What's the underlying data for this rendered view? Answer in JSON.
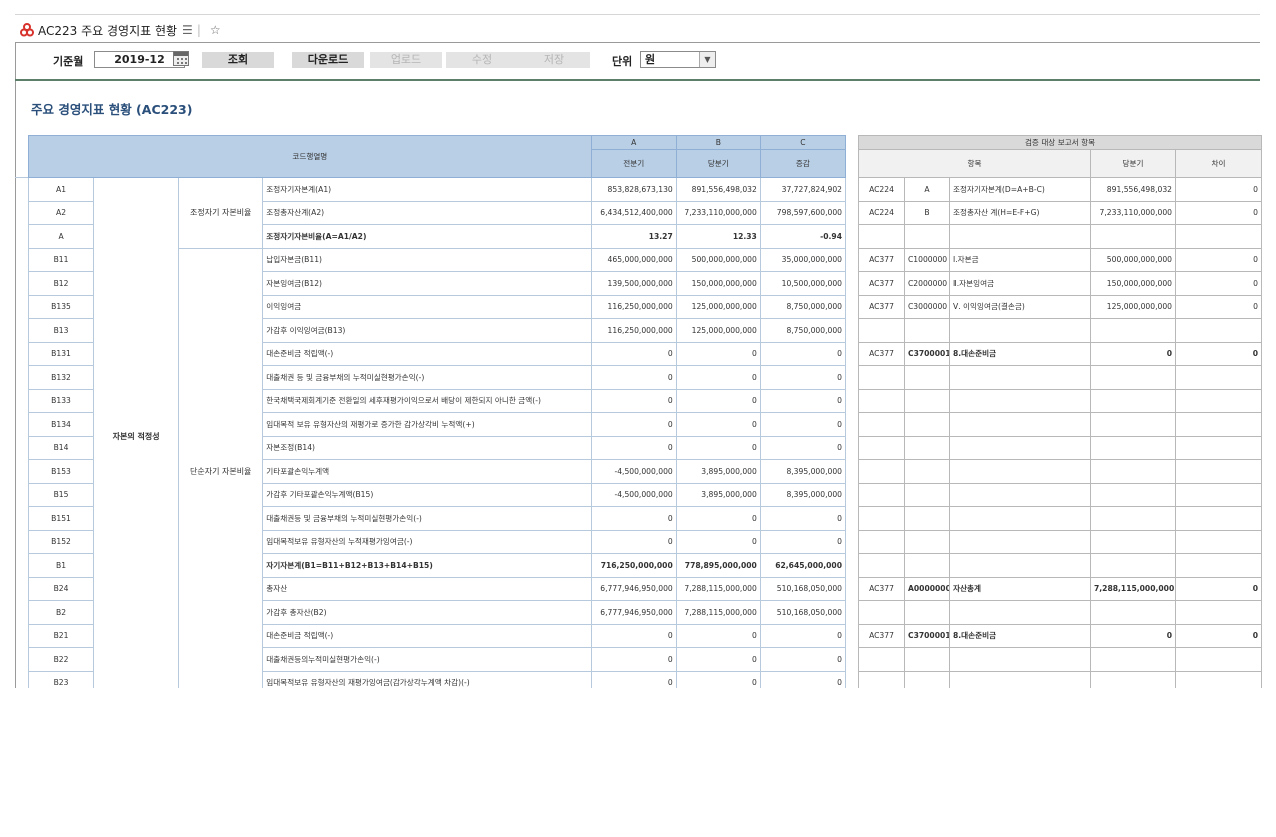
{
  "title_bar": {
    "title": "AC223 주요 경영지표 현황"
  },
  "toolbar": {
    "period_label": "기준월",
    "period_value": "2019-12",
    "search_label": "조회",
    "download_label": "다운로드",
    "upload_label": "업로드",
    "edit_label": "수정",
    "save_label": "저장",
    "unit_label": "단위",
    "unit_value": "원"
  },
  "page_title": "주요 경영지표 현황 (AC223)",
  "main_header": {
    "code_label": "코드행열명",
    "col_a": "A",
    "col_b": "B",
    "col_c": "C",
    "col_a_sub": "전분기",
    "col_b_sub": "당분기",
    "col_c_sub": "증감"
  },
  "side_header": {
    "group": "검증 대상 보고서 항목",
    "item": "항목",
    "current": "당분기",
    "diff": "차이"
  },
  "groups": {
    "level1_bottom": "자본의 적정성",
    "level2_adj": "조정자기 자본비율",
    "level2_simple": "단순자기 자본비율"
  },
  "rows": [
    {
      "code": "A1",
      "name": "조정자기자본계(A1)",
      "a": "853,828,673,130",
      "b": "891,556,498,032",
      "c": "37,727,824,902",
      "bold": false,
      "v": {
        "rpt": "AC224",
        "acct": "A",
        "item": "조정자기자본계(D=A+B-C)",
        "cur": "891,556,498,032",
        "diff": "0",
        "bold": false
      }
    },
    {
      "code": "A2",
      "name": "조정총자산계(A2)",
      "a": "6,434,512,400,000",
      "b": "7,233,110,000,000",
      "c": "798,597,600,000",
      "bold": false,
      "v": {
        "rpt": "AC224",
        "acct": "B",
        "item": "조정총자산 계(H=E-F+G)",
        "cur": "7,233,110,000,000",
        "diff": "0",
        "bold": false
      }
    },
    {
      "code": "A",
      "name": "조정자기자본비율(A=A1/A2)",
      "a": "13.27",
      "b": "12.33",
      "c": "-0.94",
      "bold": true,
      "v": {
        "rpt": "",
        "acct": "",
        "item": "",
        "cur": "",
        "diff": "",
        "bold": false
      }
    },
    {
      "code": "B11",
      "name": "납입자본금(B11)",
      "a": "465,000,000,000",
      "b": "500,000,000,000",
      "c": "35,000,000,000",
      "bold": false,
      "v": {
        "rpt": "AC377",
        "acct": "C1000000",
        "item": "Ⅰ.자본금",
        "cur": "500,000,000,000",
        "diff": "0",
        "bold": false
      }
    },
    {
      "code": "B12",
      "name": "자본잉여금(B12)",
      "a": "139,500,000,000",
      "b": "150,000,000,000",
      "c": "10,500,000,000",
      "bold": false,
      "v": {
        "rpt": "AC377",
        "acct": "C2000000",
        "item": "Ⅱ.자본잉여금",
        "cur": "150,000,000,000",
        "diff": "0",
        "bold": false
      }
    },
    {
      "code": "B135",
      "name": "이익잉여금",
      "a": "116,250,000,000",
      "b": "125,000,000,000",
      "c": "8,750,000,000",
      "bold": false,
      "v": {
        "rpt": "AC377",
        "acct": "C3000000",
        "item": "Ⅴ. 이익잉여금(결손금)",
        "cur": "125,000,000,000",
        "diff": "0",
        "bold": false
      }
    },
    {
      "code": "B13",
      "name": "가감후 이익잉여금(B13)",
      "a": "116,250,000,000",
      "b": "125,000,000,000",
      "c": "8,750,000,000",
      "bold": false,
      "v": {
        "rpt": "",
        "acct": "",
        "item": "",
        "cur": "",
        "diff": "",
        "bold": false
      }
    },
    {
      "code": "B131",
      "name": "대손준비금 적립액(-)",
      "a": "0",
      "b": "0",
      "c": "0",
      "bold": false,
      "v": {
        "rpt": "AC377",
        "acct": "C3700001",
        "item": "8.대손준비금",
        "cur": "0",
        "diff": "0",
        "bold": true
      }
    },
    {
      "code": "B132",
      "name": "대출채권 등 및 금융부채의 누적미실현평가손익(-)",
      "a": "0",
      "b": "0",
      "c": "0",
      "bold": false,
      "v": {
        "rpt": "",
        "acct": "",
        "item": "",
        "cur": "",
        "diff": "",
        "bold": false
      }
    },
    {
      "code": "B133",
      "name": "한국채택국제회계기준 전환일의 세후재평가이익으로서 배당이 제한되지 아니한 금액(-)",
      "a": "0",
      "b": "0",
      "c": "0",
      "bold": false,
      "v": {
        "rpt": "",
        "acct": "",
        "item": "",
        "cur": "",
        "diff": "",
        "bold": false
      }
    },
    {
      "code": "B134",
      "name": "임대목적 보유 유형자산의 재평가로 증가한 감가상각비 누적액(+)",
      "a": "0",
      "b": "0",
      "c": "0",
      "bold": false,
      "v": {
        "rpt": "",
        "acct": "",
        "item": "",
        "cur": "",
        "diff": "",
        "bold": false
      }
    },
    {
      "code": "B14",
      "name": "자본조정(B14)",
      "a": "0",
      "b": "0",
      "c": "0",
      "bold": false,
      "v": {
        "rpt": "",
        "acct": "",
        "item": "",
        "cur": "",
        "diff": "",
        "bold": false
      }
    },
    {
      "code": "B153",
      "name": "기타포괄손익누계액",
      "a": "-4,500,000,000",
      "b": "3,895,000,000",
      "c": "8,395,000,000",
      "bold": false,
      "v": {
        "rpt": "",
        "acct": "",
        "item": "",
        "cur": "",
        "diff": "",
        "bold": false
      }
    },
    {
      "code": "B15",
      "name": "가감후 기타포괄손익누계액(B15)",
      "a": "-4,500,000,000",
      "b": "3,895,000,000",
      "c": "8,395,000,000",
      "bold": false,
      "v": {
        "rpt": "",
        "acct": "",
        "item": "",
        "cur": "",
        "diff": "",
        "bold": false
      }
    },
    {
      "code": "B151",
      "name": "대출채권등 및 금융부채의 누적미실현평가손익(-)",
      "a": "0",
      "b": "0",
      "c": "0",
      "bold": false,
      "v": {
        "rpt": "",
        "acct": "",
        "item": "",
        "cur": "",
        "diff": "",
        "bold": false
      }
    },
    {
      "code": "B152",
      "name": "임대목적보유 유형자산의 누적재평가잉여금(-)",
      "a": "0",
      "b": "0",
      "c": "0",
      "bold": false,
      "v": {
        "rpt": "",
        "acct": "",
        "item": "",
        "cur": "",
        "diff": "",
        "bold": false
      }
    },
    {
      "code": "B1",
      "name": "자기자본계(B1=B11+B12+B13+B14+B15)",
      "a": "716,250,000,000",
      "b": "778,895,000,000",
      "c": "62,645,000,000",
      "bold": true,
      "v": {
        "rpt": "",
        "acct": "",
        "item": "",
        "cur": "",
        "diff": "",
        "bold": false
      }
    },
    {
      "code": "B24",
      "name": "총자산",
      "a": "6,777,946,950,000",
      "b": "7,288,115,000,000",
      "c": "510,168,050,000",
      "bold": false,
      "v": {
        "rpt": "AC377",
        "acct": "A0000000",
        "item": "자산총계",
        "cur": "7,288,115,000,000",
        "diff": "0",
        "bold": true
      }
    },
    {
      "code": "B2",
      "name": "가감후 총자산(B2)",
      "a": "6,777,946,950,000",
      "b": "7,288,115,000,000",
      "c": "510,168,050,000",
      "bold": false,
      "v": {
        "rpt": "",
        "acct": "",
        "item": "",
        "cur": "",
        "diff": "",
        "bold": false
      }
    },
    {
      "code": "B21",
      "name": "대손준비금 적립액(-)",
      "a": "0",
      "b": "0",
      "c": "0",
      "bold": false,
      "v": {
        "rpt": "AC377",
        "acct": "C3700001",
        "item": "8.대손준비금",
        "cur": "0",
        "diff": "0",
        "bold": true
      }
    },
    {
      "code": "B22",
      "name": "대출채권등의누적미실현평가손익(-)",
      "a": "0",
      "b": "0",
      "c": "0",
      "bold": false,
      "v": {
        "rpt": "",
        "acct": "",
        "item": "",
        "cur": "",
        "diff": "",
        "bold": false
      }
    },
    {
      "code": "B23",
      "name": "임대목적보유 유형자산의 재평가잉여금(감가상각누계액 차감)(-)",
      "a": "0",
      "b": "0",
      "c": "0",
      "bold": false,
      "v": {
        "rpt": "",
        "acct": "",
        "item": "",
        "cur": "",
        "diff": "",
        "bold": false
      }
    }
  ]
}
